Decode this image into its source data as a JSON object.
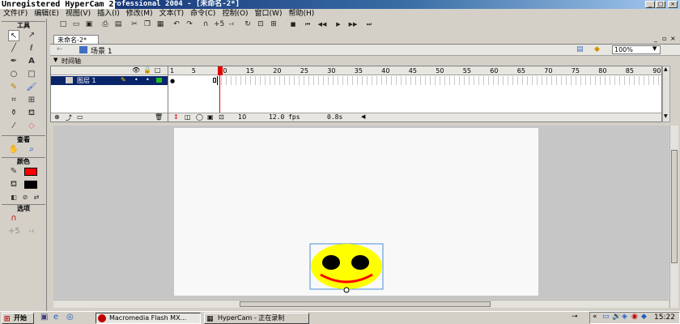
{
  "watermark": "Unregistered HyperCam 2",
  "window": {
    "title": "rofessional 2004 - [未命名-2*]"
  },
  "menu": [
    "文件(F)",
    "编辑(E)",
    "视图(V)",
    "插入(I)",
    "修改(M)",
    "文本(T)",
    "命令(C)",
    "控制(O)",
    "窗口(W)",
    "帮助(H)"
  ],
  "tools": {
    "header": "工具",
    "view_header": "查看",
    "colors_header": "颜色",
    "options_header": "选项"
  },
  "document": {
    "tab": "未命名-2*",
    "scene": "场景 1",
    "zoom": "100%",
    "timeline_label": "时间轴"
  },
  "timeline": {
    "layer_name": "图层 1",
    "frame_numbers": [
      "1",
      "5",
      "10",
      "15",
      "20",
      "25",
      "30",
      "35",
      "40",
      "45",
      "50",
      "55",
      "60",
      "65",
      "70",
      "75",
      "80",
      "85",
      "90"
    ],
    "current_frame": "10",
    "fps": "12.0 fps",
    "time": "0.8s"
  },
  "taskbar": {
    "start": "开始",
    "tasks": [
      "Macromedia Flash MX...",
      "HyperCam - 正在录制"
    ],
    "clock": "15:22"
  },
  "colors": {
    "stroke": "#ff0000",
    "fill": "#000000",
    "face": "#ffff00",
    "smile": "#ff0000",
    "playhead": "#e00000"
  }
}
